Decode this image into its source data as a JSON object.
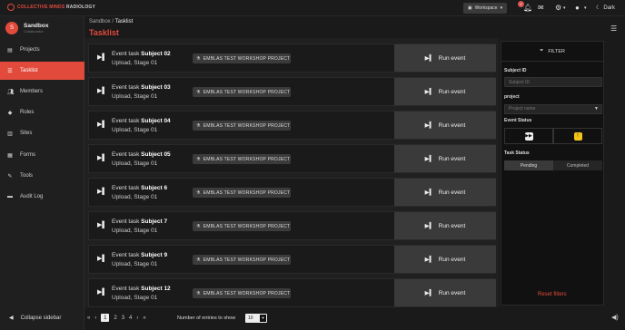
{
  "brand": {
    "prefix": "COLLECTIVE MINDS",
    "suffix": "RADIOLOGY"
  },
  "topbar": {
    "workspace_label": "Workspace",
    "notification_count": "2",
    "theme_label": "Dark"
  },
  "sidebar": {
    "user_initial": "S",
    "user_name": "Sandbox",
    "user_sub": "Collaborator",
    "items": [
      {
        "label": "Projects",
        "icon": "folder-icon"
      },
      {
        "label": "Tasklist",
        "icon": "list-icon"
      },
      {
        "label": "Members",
        "icon": "users-icon"
      },
      {
        "label": "Roles",
        "icon": "roles-icon"
      },
      {
        "label": "Sites",
        "icon": "building-icon"
      },
      {
        "label": "Forms",
        "icon": "form-icon"
      },
      {
        "label": "Tools",
        "icon": "tools-icon"
      },
      {
        "label": "Audit Log",
        "icon": "audit-icon"
      }
    ],
    "collapse_label": "Collapse sidebar"
  },
  "breadcrumb": {
    "root": "Sandbox",
    "separator": "/",
    "current": "Tasklist"
  },
  "page_title": "Tasklist",
  "tasks": [
    {
      "prefix": "Event task ",
      "subject": "Subject 02",
      "sub": "Upload, Stage 01",
      "project": "EMBLAS TEST WORKSHOP PROJECT",
      "action": "Run event"
    },
    {
      "prefix": "Event task ",
      "subject": "Subject 03",
      "sub": "Upload, Stage 01",
      "project": "EMBLAS TEST WORKSHOP PROJECT",
      "action": "Run event"
    },
    {
      "prefix": "Event task ",
      "subject": "Subject 04",
      "sub": "Upload, Stage 01",
      "project": "EMBLAS TEST WORKSHOP PROJECT",
      "action": "Run event"
    },
    {
      "prefix": "Event task ",
      "subject": "Subject 05",
      "sub": "Upload, Stage 01",
      "project": "EMBLAS TEST WORKSHOP PROJECT",
      "action": "Run event"
    },
    {
      "prefix": "Event task ",
      "subject": "Subject 6",
      "sub": "Upload, Stage 01",
      "project": "EMBLAS TEST WORKSHOP PROJECT",
      "action": "Run event"
    },
    {
      "prefix": "Event task ",
      "subject": "Subject 7",
      "sub": "Upload, Stage 01",
      "project": "EMBLAS TEST WORKSHOP PROJECT",
      "action": "Run event"
    },
    {
      "prefix": "Event task ",
      "subject": "Subject 9",
      "sub": "Upload, Stage 01",
      "project": "EMBLAS TEST WORKSHOP PROJECT",
      "action": "Run event"
    },
    {
      "prefix": "Event task ",
      "subject": "Subject 12",
      "sub": "Upload, Stage 01",
      "project": "EMBLAS TEST WORKSHOP PROJECT",
      "action": "Run event"
    }
  ],
  "filter": {
    "title": "FILTER",
    "subject_label": "Subject ID",
    "subject_placeholder": "Subject ID",
    "project_label": "project",
    "project_placeholder": "Project name",
    "status_label": "Event Status",
    "task_status_label": "Task Status",
    "pending_label": "Pending",
    "completed_label": "Completed",
    "reset_label": "Reset filters"
  },
  "pagination": {
    "pages": [
      "1",
      "2",
      "3",
      "4"
    ],
    "current": "1",
    "entries_label": "Number of entries to show",
    "entries_value": "10"
  },
  "colors": {
    "accent": "#e24b3b",
    "background": "#1a1a1a",
    "warning": "#f0c419"
  }
}
